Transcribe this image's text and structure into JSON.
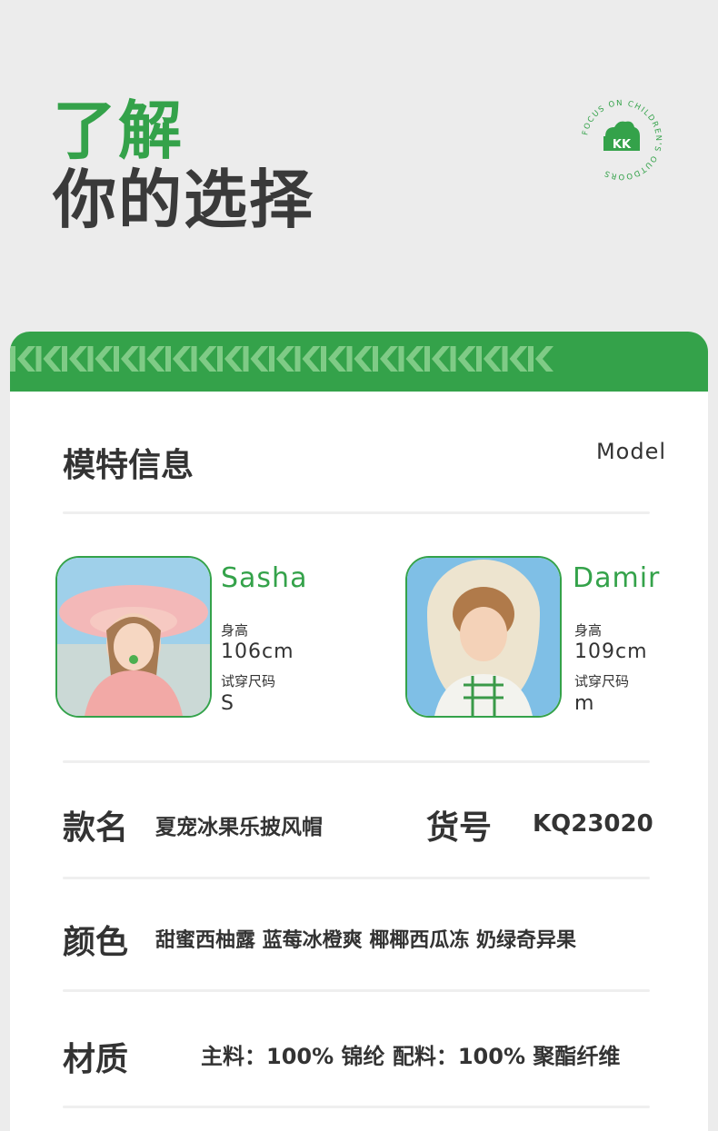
{
  "hero": {
    "title_line1": "了解",
    "title_line2": "你的选择"
  },
  "logo": {
    "mark": "KK",
    "ring_text": "FOCUS ON CHILDREN'S OUTDOORS"
  },
  "colors": {
    "brand_green": "#34a24a",
    "text_dark": "#333333",
    "background": "#ececec"
  },
  "model_section": {
    "title": "模特信息",
    "title_en": "Model",
    "models": [
      {
        "name": "Sasha",
        "height_label": "身高",
        "height": "106cm",
        "size_label": "试穿尺码",
        "size": "S"
      },
      {
        "name": "Damir",
        "height_label": "身高",
        "height": "109cm",
        "size_label": "试穿尺码",
        "size": "m"
      }
    ]
  },
  "product": {
    "name_label": "款名",
    "name_value": "夏宠冰果乐披风帽",
    "sku_label": "货号",
    "sku_value": "KQ23020",
    "color_label": "颜色",
    "color_value": "甜蜜西柚露 蓝莓冰橙爽 椰椰西瓜冻 奶绿奇异果",
    "material_label": "材质",
    "material_value": "主料：100% 锦纶 配料：100% 聚酯纤维"
  }
}
